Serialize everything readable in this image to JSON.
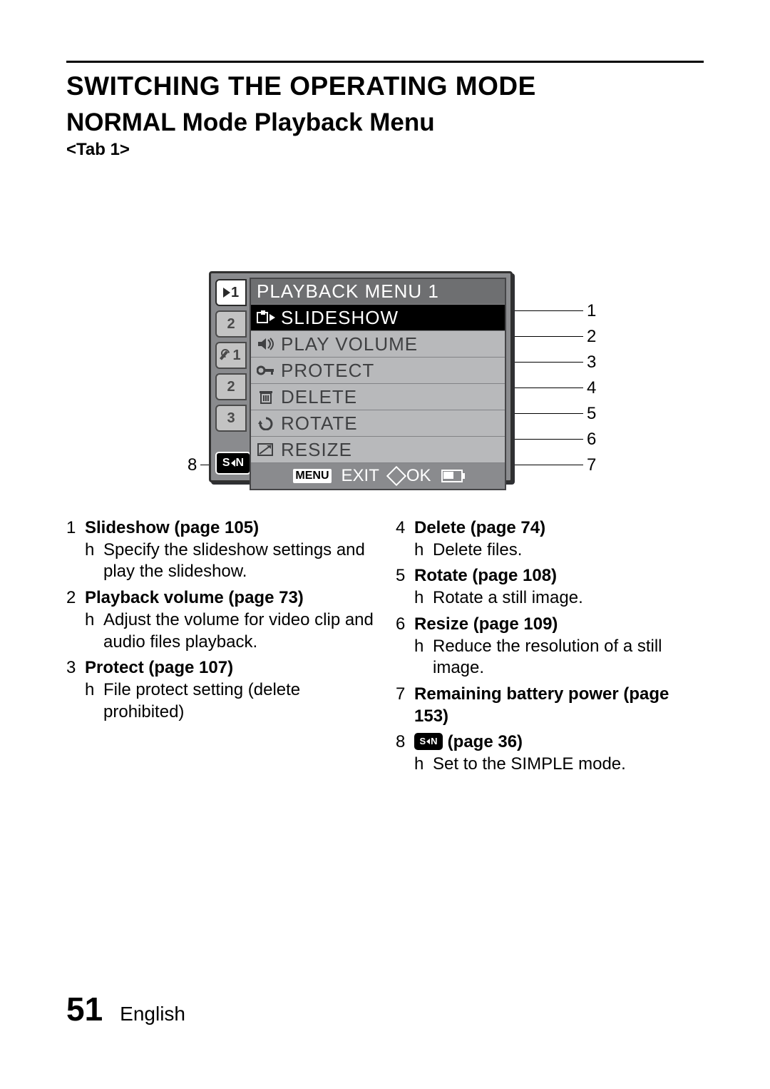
{
  "heading": "SWITCHING THE OPERATING MODE",
  "subheading": "NORMAL Mode Playback Menu",
  "tab_label": "<Tab 1>",
  "screen": {
    "title": "PLAYBACK MENU 1",
    "items": [
      {
        "label": "SLIDESHOW",
        "icon": "slideshow-icon"
      },
      {
        "label": "PLAY VOLUME",
        "icon": "volume-icon"
      },
      {
        "label": "PROTECT",
        "icon": "key-icon"
      },
      {
        "label": "DELETE",
        "icon": "trash-icon"
      },
      {
        "label": "ROTATE",
        "icon": "rotate-icon"
      },
      {
        "label": "RESIZE",
        "icon": "resize-icon"
      }
    ],
    "footer": {
      "menu_chip": "MENU",
      "exit": "EXIT",
      "ok": "OK"
    },
    "side_tabs_play": [
      "1",
      "2"
    ],
    "side_tabs_setup": [
      "1",
      "2",
      "3"
    ]
  },
  "callouts": [
    "1",
    "2",
    "3",
    "4",
    "5",
    "6",
    "7",
    "8"
  ],
  "desc_left": [
    {
      "n": "1",
      "title": "Slideshow (page 105)",
      "sub": "Specify the slideshow settings and play the slideshow."
    },
    {
      "n": "2",
      "title": "Playback volume (page 73)",
      "sub": "Adjust the volume for video clip and audio files playback."
    },
    {
      "n": "3",
      "title": "Protect (page 107)",
      "sub": "File protect setting (delete prohibited)"
    }
  ],
  "desc_right": [
    {
      "n": "4",
      "title": "Delete (page 74)",
      "sub": "Delete files."
    },
    {
      "n": "5",
      "title": "Rotate (page 108)",
      "sub": "Rotate a still image."
    },
    {
      "n": "6",
      "title": "Resize (page 109)",
      "sub": "Reduce the resolution of a still image."
    },
    {
      "n": "7",
      "title": "Remaining battery power (page 153)",
      "sub": ""
    },
    {
      "n": "8",
      "title": " (page 36)",
      "sub": "Set to the SIMPLE mode.",
      "sn": true
    }
  ],
  "footer": {
    "page": "51",
    "lang": "English"
  },
  "bullet_char": "h"
}
